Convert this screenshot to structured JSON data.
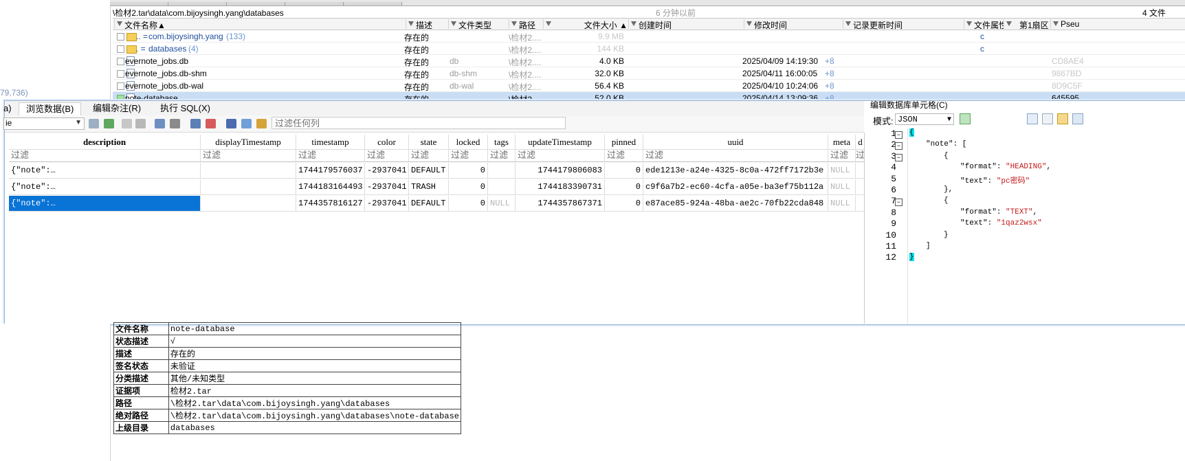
{
  "left_panel": {
    "partial_text": "79,736)"
  },
  "path_bar": {
    "path": "\\检材2.tar\\data\\com.bijoysingh.yang\\databases",
    "ago": "6 分钟以前",
    "count": "4 文件"
  },
  "file_table": {
    "headers": [
      "文件名称",
      "描述",
      "文件类型",
      "路径",
      "文件大小",
      "创建时间",
      "修改时间",
      "记录更新时间",
      "文件属性",
      "第1扇区",
      "Pseu"
    ],
    "rows": [
      {
        "prefix": "..  =",
        "name": "com.bijoysingh.yang",
        "count": "(133)",
        "desc": "存在的",
        "type": "",
        "path": "\\检材2....",
        "size": "9.9 MB",
        "modified": "",
        "tz": "",
        "attr": "c",
        "pseu": ""
      },
      {
        "prefix": ".   =",
        "name": "databases",
        "count": "(4)",
        "desc": "存在的",
        "type": "",
        "path": "\\检材2....",
        "size": "144 KB",
        "modified": "",
        "tz": "",
        "attr": "c",
        "pseu": ""
      },
      {
        "prefix": "",
        "name": "evernote_jobs.db",
        "count": "",
        "desc": "存在的",
        "type": "db",
        "path": "\\检材2....",
        "size": "4.0 KB",
        "modified": "2025/04/09  14:19:30",
        "tz": "+8",
        "attr": "",
        "pseu": "CD8AE4"
      },
      {
        "prefix": "",
        "name": "evernote_jobs.db-shm",
        "count": "",
        "desc": "存在的",
        "type": "db-shm",
        "path": "\\检材2....",
        "size": "32.0 KB",
        "modified": "2025/04/11  16:00:05",
        "tz": "+8",
        "attr": "",
        "pseu": "9867BD"
      },
      {
        "prefix": "",
        "name": "evernote_jobs.db-wal",
        "count": "",
        "desc": "存在的",
        "type": "db-wal",
        "path": "\\检材2....",
        "size": "56.4 KB",
        "modified": "2025/04/10  10:24:06",
        "tz": "+8",
        "attr": "",
        "pseu": "8D9C5F"
      },
      {
        "prefix": "",
        "name": "note-database",
        "count": "",
        "desc": "存在的, ...",
        "type": "",
        "path": "\\检材2....",
        "size": "52.0 KB",
        "modified": "2025/04/14  13:09:36",
        "tz": "+8",
        "attr": "",
        "pseu": "645595"
      }
    ]
  },
  "sql_window": {
    "tabs": [
      "a)",
      "浏览数据(B)",
      "编辑杂注(R)",
      "执行 SQL(X)"
    ],
    "table_select": "ie",
    "filter_placeholder": "过滤任何列",
    "columns": [
      "description",
      "displayTimestamp",
      "timestamp",
      "color",
      "state",
      "locked",
      "tags",
      "updateTimestamp",
      "pinned",
      "uuid",
      "meta",
      "d"
    ],
    "filter_label": "过滤",
    "rows": [
      {
        "description": "{\"note\":…",
        "displayTimestamp": "",
        "timestamp": "1744179576037",
        "color": "-2937041",
        "state": "DEFAULT",
        "locked": "0",
        "tags": "",
        "updateTimestamp": "1744179806083",
        "pinned": "0",
        "uuid": "ede1213e-a24e-4325-8c0a-472ff7172b3e",
        "meta": "NULL"
      },
      {
        "description": "{\"note\":…",
        "displayTimestamp": "",
        "timestamp": "1744183164493",
        "color": "-2937041",
        "state": "TRASH",
        "locked": "0",
        "tags": "",
        "updateTimestamp": "1744183390731",
        "pinned": "0",
        "uuid": "c9f6a7b2-ec60-4cfa-a05e-ba3ef75b112a",
        "meta": "NULL"
      },
      {
        "description": "{\"note\":…",
        "displayTimestamp": "",
        "timestamp": "1744357816127",
        "color": "-2937041",
        "state": "DEFAULT",
        "locked": "0",
        "tags": "NULL",
        "updateTimestamp": "1744357867371",
        "pinned": "0",
        "uuid": "e87ace85-924a-48ba-ae2c-70fb22cda848",
        "meta": "NULL"
      }
    ],
    "editor": {
      "title": "编辑数据库单元格(C)",
      "mode_label": "模式:",
      "mode_value": "JSON",
      "line_numbers": [
        "1",
        "2",
        "3",
        "4",
        "5",
        "6",
        "7",
        "8",
        "9",
        "10",
        "11",
        "12"
      ],
      "code": {
        "l1": "{",
        "l2_key": "\"note\"",
        "l2_rest": ": [",
        "l3": "{",
        "l4_key": "\"format\"",
        "l4_val": "\"HEADING\"",
        "l5_key": "\"text\"",
        "l5_val": "\"pc密码\"",
        "l6": "},",
        "l7": "{",
        "l8_key": "\"format\"",
        "l8_val": "\"TEXT\"",
        "l9_key": "\"text\"",
        "l9_val": "\"1qaz2wsx\"",
        "l10": "}",
        "l11": "]",
        "l12": "}"
      }
    }
  },
  "properties": [
    {
      "key": "文件名称",
      "value": "note-database"
    },
    {
      "key": "状态描述",
      "value": "√"
    },
    {
      "key": "描述",
      "value": "存在的"
    },
    {
      "key": "签名状态",
      "value": "未验证"
    },
    {
      "key": "分类描述",
      "value": "其他/未知类型"
    },
    {
      "key": "证据项",
      "value": "检材2.tar"
    },
    {
      "key": "路径",
      "value": "\\检材2.tar\\data\\com.bijoysingh.yang\\databases"
    },
    {
      "key": "绝对路径",
      "value": "\\检材2.tar\\data\\com.bijoysingh.yang\\databases\\note-database"
    },
    {
      "key": "上级目录",
      "value": "databases"
    }
  ]
}
